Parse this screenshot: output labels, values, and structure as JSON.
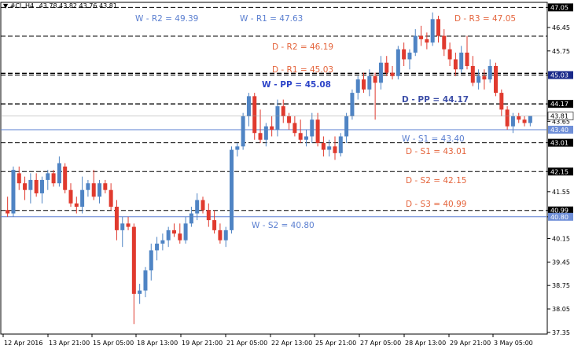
{
  "symbol_header": {
    "symbol": "#CL,H4",
    "ohlc": "43.78 43.82 43.76 43.81"
  },
  "chart_data": {
    "type": "candlestick",
    "ylim": [
      37.3,
      47.2
    ],
    "price_scale": [
      "47.05",
      "46.45",
      "45.75",
      "45.03",
      "44.17",
      "43.65",
      "43.01",
      "42.15",
      "41.55",
      "40.99",
      "40.80",
      "40.15",
      "39.45",
      "38.75",
      "38.05",
      "37.35"
    ],
    "current_price": "43.81",
    "x_ticks": [
      "12 Apr 2016",
      "13 Apr 21:00",
      "15 Apr 05:00",
      "18 Apr 13:00",
      "19 Apr 21:00",
      "21 Apr 05:00",
      "22 Apr 13:00",
      "25 Apr 21:00",
      "27 Apr 05:00",
      "28 Apr 13:00",
      "29 Apr 21:00",
      "3 May 05:00"
    ],
    "levels": [
      {
        "label": "W - R2 = 49.39",
        "price": null,
        "color": "#5b7fd0",
        "style": "none"
      },
      {
        "label": "W - R1 = 47.63",
        "price": null,
        "color": "#5b7fd0",
        "style": "none"
      },
      {
        "label": "D - R3 = 47.05",
        "price": 47.05,
        "color": "#e4643c",
        "style": "dash"
      },
      {
        "label": "D - R2 = 46.19",
        "price": 46.19,
        "color": "#e4643c",
        "style": "dash"
      },
      {
        "label": "D - R1 = 45.03",
        "price": 45.03,
        "color": "#e4643c",
        "style": "dash"
      },
      {
        "label": "W - PP = 45.08",
        "price": 45.08,
        "color": "#2d44c8",
        "style": "dash",
        "bold": true
      },
      {
        "label": "D - PP = 44.17",
        "price": 44.17,
        "color": "#3d4fa8",
        "style": "dash",
        "bold": true
      },
      {
        "label": "W - S1 = 43.40",
        "price": 43.4,
        "color": "#5b7fd0",
        "style": "solid"
      },
      {
        "label": "D - S1 = 43.01",
        "price": 43.01,
        "color": "#e4643c",
        "style": "dash"
      },
      {
        "label": "D - S2 = 42.15",
        "price": 42.15,
        "color": "#e4643c",
        "style": "dash"
      },
      {
        "label": "D - S3 = 40.99",
        "price": 40.99,
        "color": "#e4643c",
        "style": "dash"
      },
      {
        "label": "W - S2 = 40.80",
        "price": 40.8,
        "color": "#5b7fd0",
        "style": "solid"
      }
    ],
    "candles": [
      [
        41.0,
        41.4,
        40.8,
        40.9
      ],
      [
        40.9,
        42.3,
        40.8,
        42.2
      ],
      [
        42.1,
        42.3,
        41.6,
        41.8
      ],
      [
        41.8,
        42.0,
        41.3,
        41.6
      ],
      [
        41.6,
        42.1,
        41.2,
        41.9
      ],
      [
        41.9,
        42.1,
        41.4,
        41.5
      ],
      [
        41.5,
        42.0,
        41.2,
        41.9
      ],
      [
        41.9,
        42.2,
        41.6,
        42.1
      ],
      [
        42.1,
        42.2,
        41.7,
        41.8
      ],
      [
        41.8,
        42.6,
        41.7,
        42.4
      ],
      [
        42.3,
        42.4,
        41.5,
        41.6
      ],
      [
        41.6,
        41.8,
        41.1,
        41.2
      ],
      [
        41.2,
        41.4,
        40.9,
        41.1
      ],
      [
        41.1,
        42.0,
        40.9,
        41.6
      ],
      [
        41.6,
        41.9,
        41.4,
        41.8
      ],
      [
        41.8,
        42.2,
        41.3,
        41.4
      ],
      [
        41.4,
        41.9,
        41.2,
        41.8
      ],
      [
        41.8,
        41.9,
        41.5,
        41.6
      ],
      [
        41.6,
        41.8,
        41.0,
        41.1
      ],
      [
        41.1,
        41.3,
        40.1,
        40.4
      ],
      [
        40.4,
        40.8,
        39.9,
        40.6
      ],
      [
        40.6,
        40.8,
        40.4,
        40.5
      ],
      [
        40.5,
        40.6,
        37.6,
        38.5
      ],
      [
        38.5,
        38.8,
        38.2,
        38.6
      ],
      [
        38.6,
        39.3,
        38.4,
        39.2
      ],
      [
        39.2,
        40.0,
        38.9,
        39.8
      ],
      [
        39.8,
        40.2,
        39.5,
        40.0
      ],
      [
        40.0,
        40.3,
        39.8,
        40.1
      ],
      [
        40.1,
        40.5,
        39.9,
        40.4
      ],
      [
        40.4,
        40.6,
        40.2,
        40.3
      ],
      [
        40.3,
        40.6,
        40.0,
        40.1
      ],
      [
        40.1,
        40.8,
        40.0,
        40.6
      ],
      [
        40.6,
        41.1,
        40.5,
        40.9
      ],
      [
        40.9,
        41.5,
        40.7,
        41.3
      ],
      [
        41.3,
        41.4,
        40.9,
        41.0
      ],
      [
        41.0,
        41.2,
        40.5,
        40.7
      ],
      [
        40.7,
        41.0,
        40.3,
        40.4
      ],
      [
        40.4,
        40.6,
        40.0,
        40.1
      ],
      [
        40.1,
        40.5,
        39.9,
        40.4
      ],
      [
        40.4,
        42.9,
        40.3,
        42.8
      ],
      [
        42.8,
        43.0,
        42.6,
        42.9
      ],
      [
        42.9,
        43.9,
        42.8,
        43.8
      ],
      [
        43.8,
        44.5,
        43.5,
        44.4
      ],
      [
        44.4,
        44.5,
        43.1,
        43.3
      ],
      [
        43.3,
        44.0,
        43.0,
        43.1
      ],
      [
        43.1,
        43.6,
        42.9,
        43.5
      ],
      [
        43.5,
        43.8,
        43.2,
        43.4
      ],
      [
        43.4,
        44.3,
        43.2,
        44.1
      ],
      [
        44.1,
        44.3,
        43.6,
        43.8
      ],
      [
        43.8,
        43.9,
        43.4,
        43.6
      ],
      [
        43.6,
        43.8,
        43.2,
        43.3
      ],
      [
        43.3,
        43.7,
        43.0,
        43.1
      ],
      [
        43.1,
        43.4,
        42.9,
        43.2
      ],
      [
        43.2,
        43.9,
        43.0,
        43.7
      ],
      [
        43.7,
        43.9,
        42.9,
        43.0
      ],
      [
        43.0,
        43.2,
        42.6,
        42.8
      ],
      [
        42.8,
        43.1,
        42.6,
        42.9
      ],
      [
        42.9,
        43.2,
        42.5,
        42.7
      ],
      [
        42.7,
        43.3,
        42.6,
        43.2
      ],
      [
        43.2,
        43.9,
        43.0,
        43.8
      ],
      [
        43.8,
        44.6,
        43.7,
        44.5
      ],
      [
        44.5,
        45.0,
        44.3,
        44.9
      ],
      [
        44.9,
        45.1,
        44.5,
        44.6
      ],
      [
        44.6,
        45.2,
        44.4,
        45.0
      ],
      [
        45.0,
        45.1,
        43.7,
        44.8
      ],
      [
        44.8,
        45.6,
        44.6,
        45.4
      ],
      [
        45.4,
        45.6,
        45.0,
        45.1
      ],
      [
        45.1,
        45.3,
        44.9,
        45.0
      ],
      [
        45.0,
        45.9,
        44.9,
        45.8
      ],
      [
        45.8,
        46.0,
        45.3,
        45.5
      ],
      [
        45.5,
        45.8,
        45.2,
        45.7
      ],
      [
        45.7,
        46.4,
        45.6,
        46.2
      ],
      [
        46.2,
        46.5,
        45.9,
        46.1
      ],
      [
        46.1,
        46.3,
        45.8,
        46.0
      ],
      [
        46.0,
        46.9,
        45.9,
        46.7
      ],
      [
        46.7,
        46.8,
        46.0,
        46.2
      ],
      [
        46.2,
        46.4,
        45.6,
        45.8
      ],
      [
        45.8,
        46.0,
        45.3,
        45.5
      ],
      [
        45.5,
        45.7,
        45.0,
        45.2
      ],
      [
        45.2,
        45.9,
        45.1,
        45.7
      ],
      [
        45.7,
        46.2,
        45.2,
        45.3
      ],
      [
        45.3,
        45.6,
        44.7,
        44.8
      ],
      [
        44.8,
        45.2,
        44.6,
        45.0
      ],
      [
        45.0,
        45.2,
        44.6,
        44.9
      ],
      [
        44.9,
        45.5,
        44.8,
        45.3
      ],
      [
        45.3,
        45.4,
        44.4,
        44.5
      ],
      [
        44.5,
        44.6,
        43.8,
        44.0
      ],
      [
        44.0,
        44.1,
        43.4,
        43.5
      ],
      [
        43.5,
        43.9,
        43.3,
        43.8
      ],
      [
        43.8,
        43.9,
        43.6,
        43.7
      ],
      [
        43.7,
        43.8,
        43.5,
        43.6
      ],
      [
        43.6,
        43.8,
        43.5,
        43.81
      ]
    ]
  }
}
